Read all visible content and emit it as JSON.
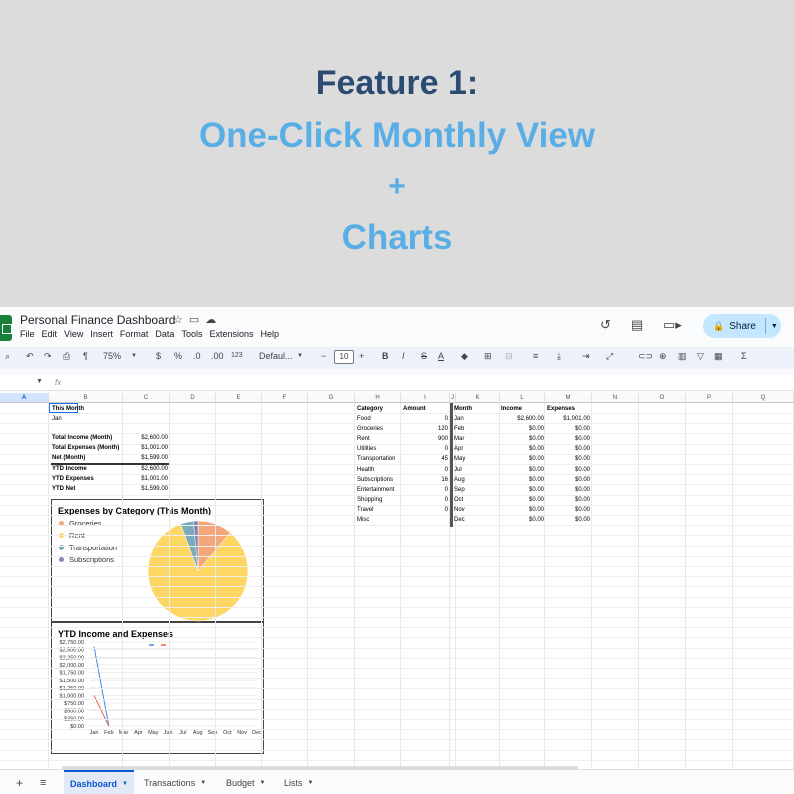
{
  "banner": {
    "line1": "Feature 1:",
    "line2": "One-Click Monthly View",
    "line3": "+",
    "line4": "Charts"
  },
  "app": {
    "title": "Personal Finance Dashboard",
    "menu": [
      "File",
      "Edit",
      "View",
      "Insert",
      "Format",
      "Data",
      "Tools",
      "Extensions",
      "Help"
    ],
    "share_label": "Share",
    "toolbar": {
      "zoom": "75%",
      "currency": "$",
      "percent": "%",
      "dec_less": ".0",
      "dec_more": ".00",
      "number_format": "123",
      "font": "Defaul...",
      "font_size": "10",
      "bold": "B",
      "italic": "I",
      "strike": "S",
      "text_color": "A",
      "sum": "Σ"
    },
    "fx_symbol": "fx"
  },
  "columns": [
    "A",
    "B",
    "C",
    "D",
    "E",
    "F",
    "G",
    "H",
    "I",
    "J",
    "K",
    "L",
    "M",
    "N",
    "O",
    "P",
    "Q"
  ],
  "summary": {
    "this_month_label": "This Month",
    "month_value": "Jan",
    "rows": [
      {
        "label": "Total Income (Month)",
        "value": "$2,600.00"
      },
      {
        "label": "Total Expenses (Month)",
        "value": "$1,001.00"
      },
      {
        "label": "Net (Month)",
        "value": "$1,599.00"
      },
      {
        "label": "YTD Income",
        "value": "$2,600.00"
      },
      {
        "label": "YTD Expenses",
        "value": "$1,001.00"
      },
      {
        "label": "YTD Net",
        "value": "$1,599.00"
      }
    ]
  },
  "category_table": {
    "headers": [
      "Category",
      "Amount"
    ],
    "rows": [
      [
        "Food",
        "0"
      ],
      [
        "Groceries",
        "120"
      ],
      [
        "Rent",
        "900"
      ],
      [
        "Utilities",
        "0"
      ],
      [
        "Transportation",
        "45"
      ],
      [
        "Health",
        "0"
      ],
      [
        "Subscriptions",
        "16"
      ],
      [
        "Entertainment",
        "0"
      ],
      [
        "Shopping",
        "0"
      ],
      [
        "Travel",
        "0"
      ],
      [
        "Misc",
        ""
      ]
    ]
  },
  "monthly_table": {
    "headers": [
      "Month",
      "Income",
      "Expenses"
    ],
    "rows": [
      [
        "Jan",
        "$2,600.00",
        "$1,001.00"
      ],
      [
        "Feb",
        "$0.00",
        "$0.00"
      ],
      [
        "Mar",
        "$0.00",
        "$0.00"
      ],
      [
        "Apr",
        "$0.00",
        "$0.00"
      ],
      [
        "May",
        "$0.00",
        "$0.00"
      ],
      [
        "Jul",
        "$0.00",
        "$0.00"
      ],
      [
        "Aug",
        "$0.00",
        "$0.00"
      ],
      [
        "Sep",
        "$0.00",
        "$0.00"
      ],
      [
        "Oct",
        "$0.00",
        "$0.00"
      ],
      [
        "Nov",
        "$0.00",
        "$0.00"
      ],
      [
        "Dec",
        "$0.00",
        "$0.00"
      ]
    ]
  },
  "chart_data": [
    {
      "type": "pie",
      "title": "Expenses by Category (This Month)",
      "legend_placement": "left",
      "categories": [
        "Groceries",
        "Rent",
        "Transportation",
        "Subscriptions"
      ],
      "values": [
        120,
        900,
        45,
        16
      ],
      "colors": [
        "#f4a77a",
        "#fdd663",
        "#7baab9",
        "#7d86b5"
      ]
    },
    {
      "type": "line",
      "title": "YTD Income and Expenses",
      "legend_placement": "top",
      "x": [
        "Jan",
        "Feb",
        "Mar",
        "Apr",
        "May",
        "Jun",
        "Jul",
        "Aug",
        "Sep",
        "Oct",
        "Nov",
        "Dec"
      ],
      "ylim": [
        0,
        2750
      ],
      "yticks": [
        "$2,750.00",
        "$2,500.00",
        "$2,250.00",
        "$2,000.00",
        "$1,750.00",
        "$1,500.00",
        "$1,250.00",
        "$1,000.00",
        "$750.00",
        "$500.00",
        "$250.00",
        "$0.00"
      ],
      "series": [
        {
          "values": [
            2600,
            0
          ],
          "color": "#4a86e8"
        },
        {
          "values": [
            1001,
            0
          ],
          "color": "#e06648"
        }
      ]
    }
  ],
  "sheet_tabs": [
    {
      "label": "Dashboard",
      "active": true
    },
    {
      "label": "Transactions",
      "active": false
    },
    {
      "label": "Budget",
      "active": false
    },
    {
      "label": "Lists",
      "active": false
    }
  ]
}
